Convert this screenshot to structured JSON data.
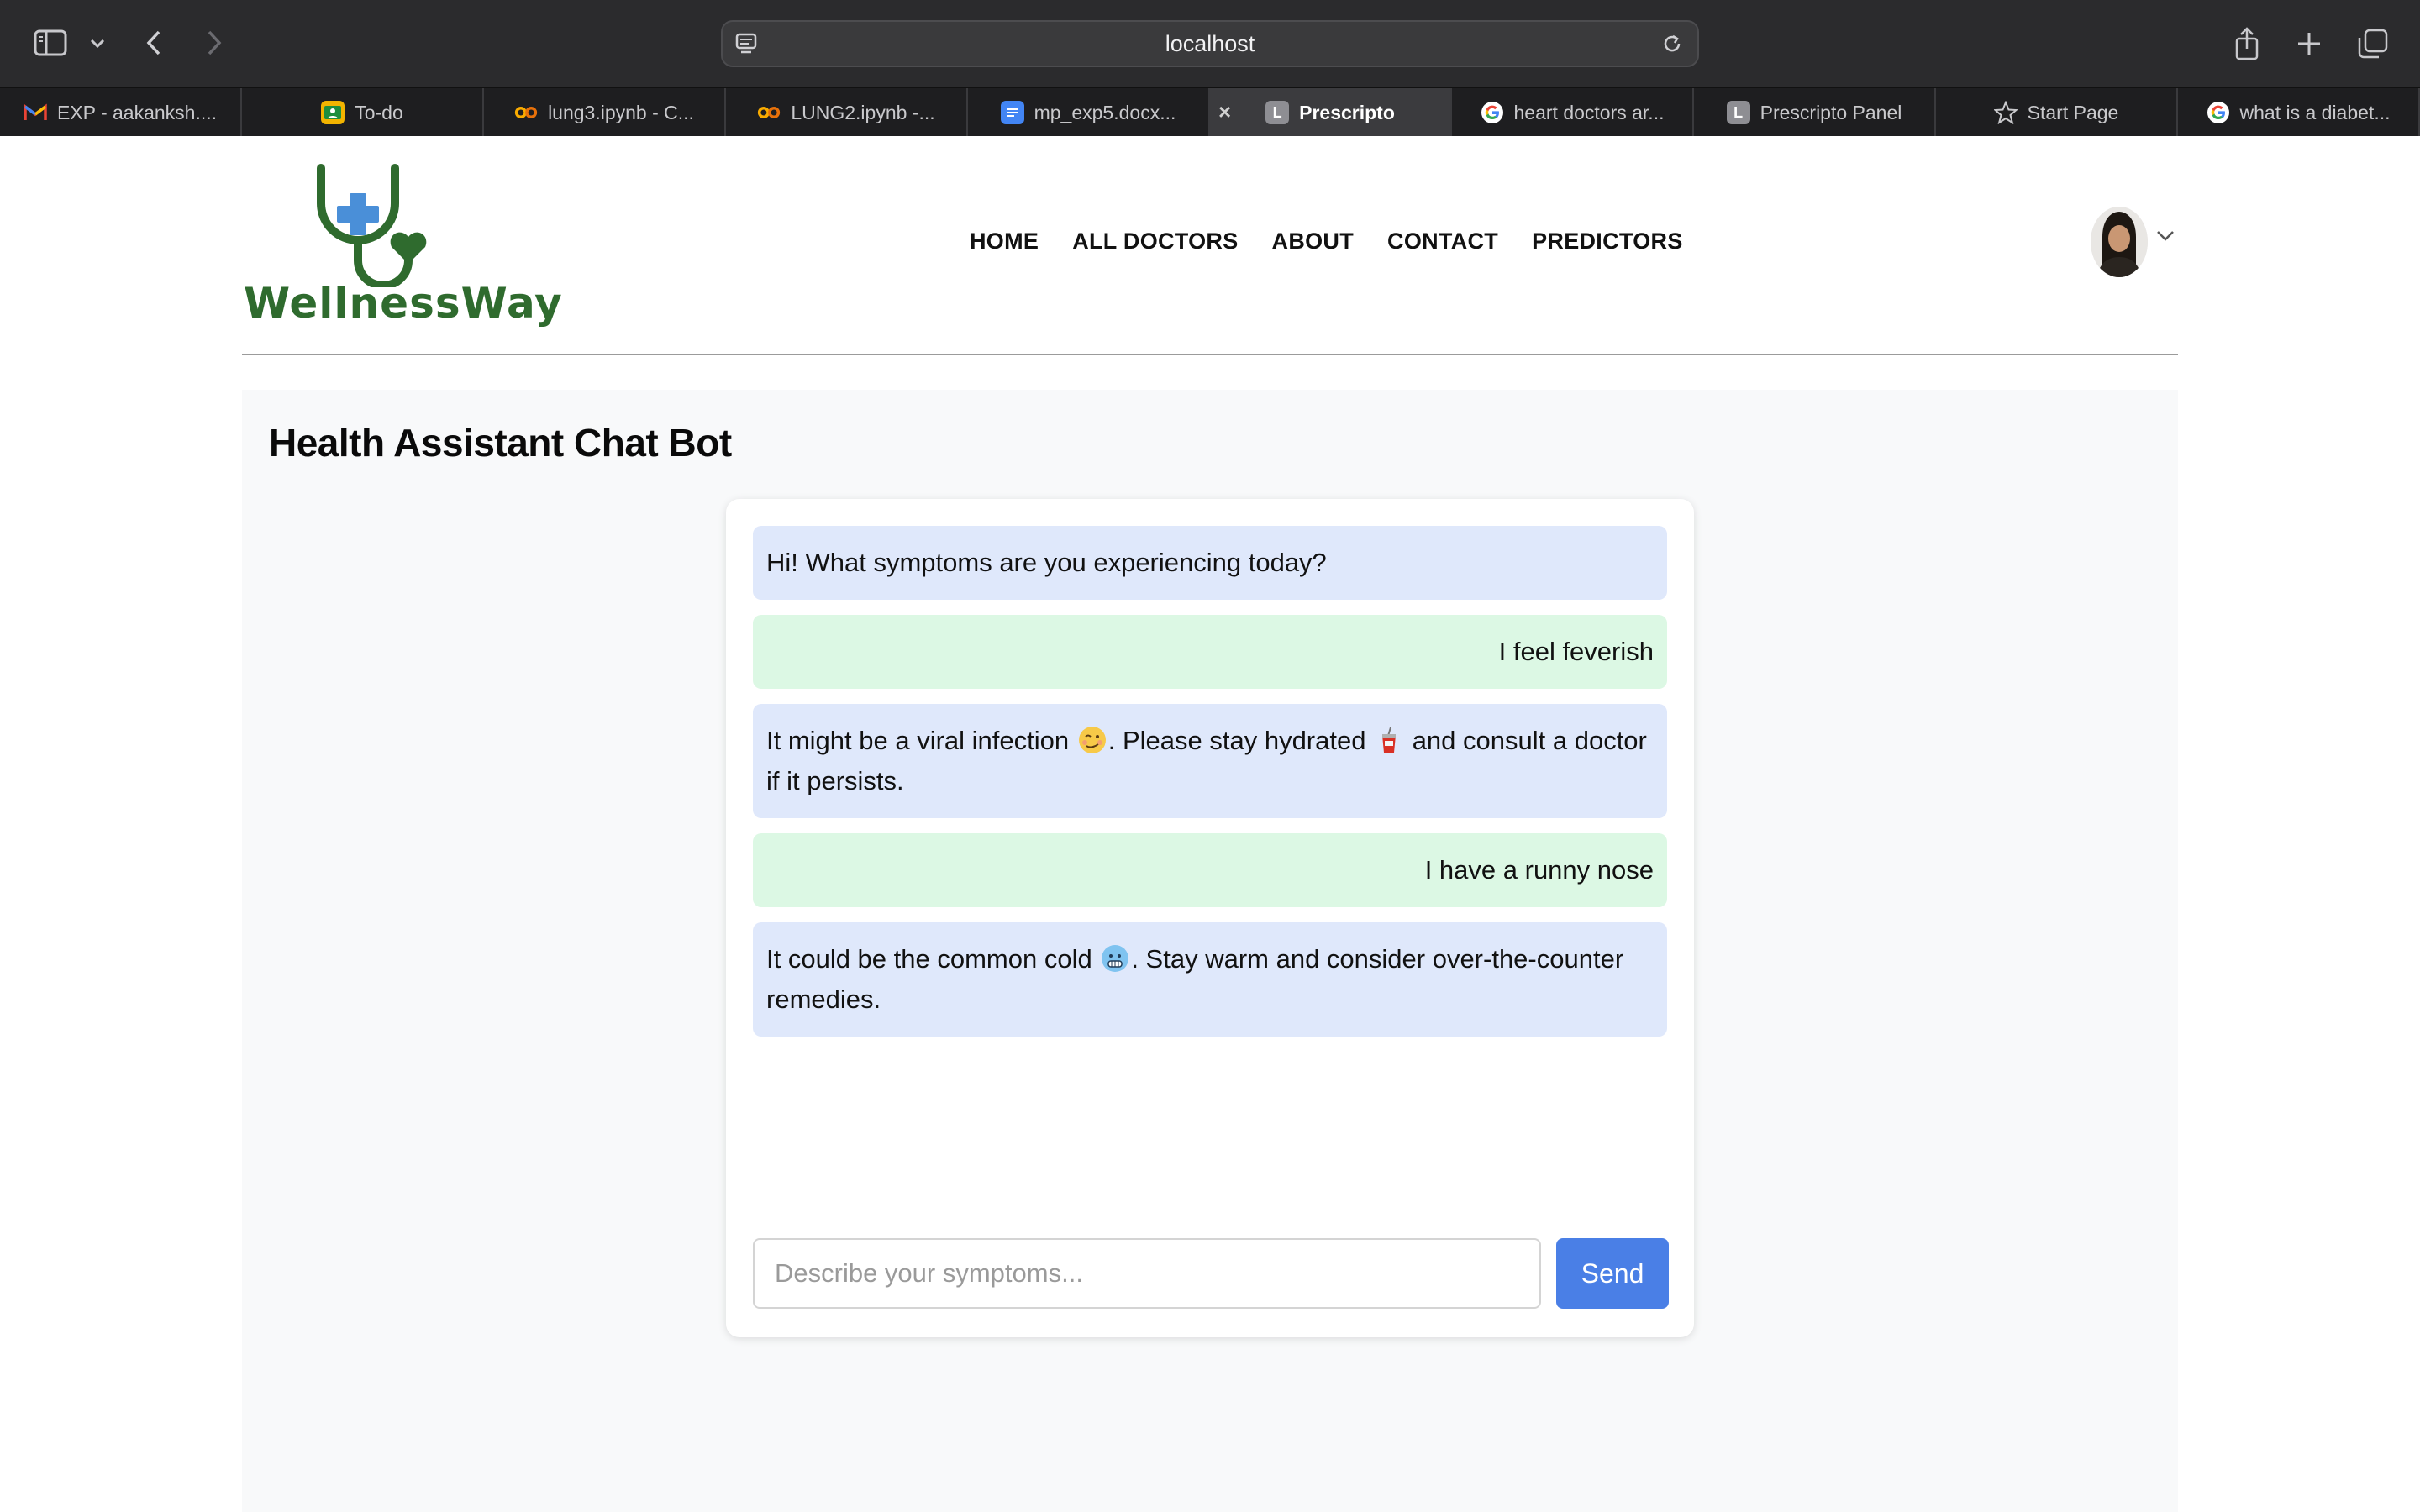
{
  "browser": {
    "address": "localhost",
    "tabs": [
      {
        "label": "EXP - aakanksh....",
        "icon": "gmail-icon",
        "active": false
      },
      {
        "label": "To-do",
        "icon": "classroom-icon",
        "active": false
      },
      {
        "label": "lung3.ipynb - C...",
        "icon": "colab-icon",
        "active": false
      },
      {
        "label": "LUNG2.ipynb -...",
        "icon": "colab-icon",
        "active": false
      },
      {
        "label": "mp_exp5.docx...",
        "icon": "docs-icon",
        "active": false
      },
      {
        "label": "Prescripto",
        "icon": "letter-l-icon",
        "icon_letter": "L",
        "active": true
      },
      {
        "label": "heart doctors ar...",
        "icon": "google-icon",
        "active": false
      },
      {
        "label": "Prescripto Panel",
        "icon": "letter-l-icon",
        "icon_letter": "L",
        "active": false
      },
      {
        "label": "Start Page",
        "icon": "star-icon",
        "active": false
      },
      {
        "label": "what is a diabet...",
        "icon": "google-icon",
        "active": false
      }
    ]
  },
  "site": {
    "logo_text": "WellnessWay",
    "brand_color": "#2f6b2e",
    "nav": [
      "HOME",
      "ALL DOCTORS",
      "ABOUT",
      "CONTACT",
      "PREDICTORS"
    ]
  },
  "chat": {
    "title": "Health Assistant Chat Bot",
    "messages": [
      {
        "role": "bot",
        "text": "Hi! What symptoms are you experiencing today?"
      },
      {
        "role": "user",
        "text": "I feel feverish"
      },
      {
        "role": "bot",
        "parts": [
          "It might be a viral infection ",
          ". Please stay hydrated ",
          " and consult a doctor if it persists."
        ],
        "emojis": [
          "woozy-face-emoji",
          "cup-with-straw-emoji"
        ]
      },
      {
        "role": "user",
        "text": "I have a runny nose"
      },
      {
        "role": "bot",
        "parts": [
          "It could be the common cold ",
          ". Stay warm and consider over-the-counter remedies."
        ],
        "emojis": [
          "cold-face-emoji"
        ]
      }
    ],
    "input_placeholder": "Describe your symptoms...",
    "send_label": "Send",
    "bot_bubble_color": "#dfe8fb",
    "user_bubble_color": "#dcf8e4",
    "send_color": "#4a7fe6"
  }
}
